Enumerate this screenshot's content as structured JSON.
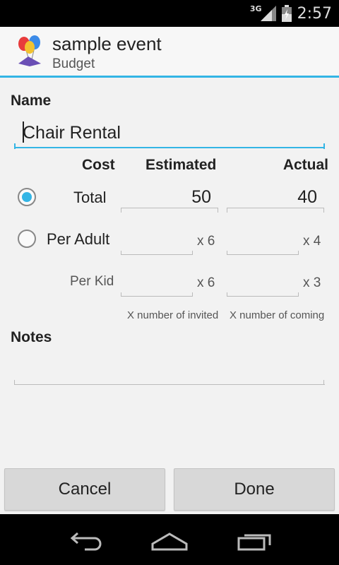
{
  "status_bar": {
    "network": "3G",
    "time": "2:57"
  },
  "action_bar": {
    "title": "sample event",
    "subtitle": "Budget"
  },
  "form": {
    "name_label": "Name",
    "name_value": "Chair Rental",
    "columns": {
      "cost": "Cost",
      "estimated": "Estimated",
      "actual": "Actual"
    },
    "rows": {
      "total": {
        "label": "Total",
        "estimated": "50",
        "actual": "40",
        "selected": true
      },
      "per_adult": {
        "label": "Per Adult",
        "estimated": "",
        "actual": "",
        "estimated_mult": "x 6",
        "actual_mult": "x 4",
        "selected": false
      },
      "per_kid": {
        "label": "Per Kid",
        "estimated": "",
        "actual": "",
        "estimated_mult": "x 6",
        "actual_mult": "x 3"
      }
    },
    "hints": {
      "estimated": "X number of invited",
      "actual": "X number of coming"
    },
    "notes_label": "Notes",
    "notes_value": ""
  },
  "buttons": {
    "cancel": "Cancel",
    "done": "Done"
  },
  "colors": {
    "accent": "#33b5e5",
    "button_bg": "#d8d8d8"
  },
  "icons": {
    "app": "balloons-icon",
    "signal": "signal-icon",
    "battery": "battery-icon",
    "back": "back-icon",
    "home": "home-icon",
    "recents": "recents-icon"
  }
}
